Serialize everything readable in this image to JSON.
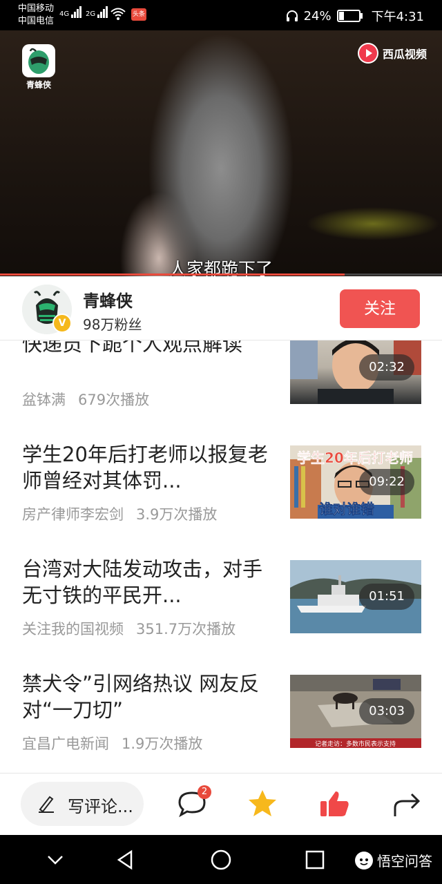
{
  "status_bar": {
    "carrier1": "中国移动",
    "carrier2": "中国电信",
    "net1": "4G",
    "net2": "2G",
    "badge": "头条",
    "battery": "24%",
    "battery_level": 0.24,
    "time": "下午4:31"
  },
  "video": {
    "channel_logo_name": "青蜂侠",
    "watermark": "西瓜视频",
    "subtitle": "人家都跪下了",
    "progress": 0.78
  },
  "channel": {
    "name": "青蜂侠",
    "fans": "98万粉丝",
    "verified": "V",
    "follow_label": "关注"
  },
  "videos": [
    {
      "title": "快递员下跪个人观点解读",
      "author": "盆钵满",
      "plays": "679次播放",
      "duration": "02:32"
    },
    {
      "title": "学生20年后打老师以报复老师曾经对其体罚...",
      "author": "房产律师李宏剑",
      "plays": "3.9万次播放",
      "duration": "09:22",
      "thumb_caption_top": "学生20年后打老师",
      "thumb_caption_bottom": "谁对谁错"
    },
    {
      "title": "台湾对大陆发动攻击，对手无寸铁的平民开...",
      "author": "关注我的国视频",
      "plays": "351.7万次播放",
      "duration": "01:51"
    },
    {
      "title": "禁犬令”引网络热议 网友反对“一刀切”",
      "author": "宜昌广电新闻",
      "plays": "1.9万次播放",
      "duration": "03:03",
      "thumb_caption_bottom": "记者走访：多数市民表示支持"
    }
  ],
  "action_bar": {
    "comment_placeholder": "写评论...",
    "comment_count": "2"
  },
  "nav": {
    "brand": "悟空问答"
  },
  "colors": {
    "accent": "#f05452",
    "badge_red": "#e84a3c",
    "star": "#f7b81c",
    "like": "#f04848",
    "verified": "#f5b81b"
  }
}
